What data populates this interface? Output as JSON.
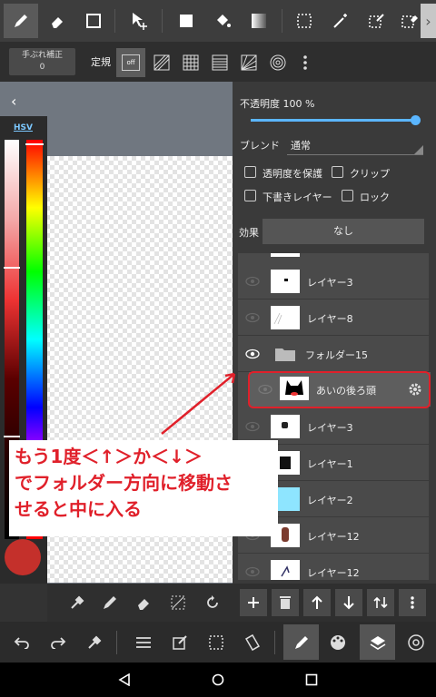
{
  "ruler_bar": {
    "stabilizer_label": "手ぶれ補正",
    "stabilizer_value": "0",
    "ruler_label": "定規",
    "off_label": "off"
  },
  "color_panel": {
    "mode_label": "HSV",
    "current_color": "#c4302b"
  },
  "layer_props": {
    "opacity_label": "不透明度 100 %",
    "opacity_value": 100,
    "blend_label": "ブレンド",
    "blend_value": "通常",
    "protect_alpha": "透明度を保護",
    "clipping": "クリップ",
    "draft_layer": "下書きレイヤー",
    "lock": "ロック",
    "effect_label": "効果",
    "effect_value": "なし"
  },
  "layers": [
    {
      "name": "レイヤー3"
    },
    {
      "name": "レイヤー8"
    },
    {
      "name": "フォルダー15"
    },
    {
      "name": "あいの後ろ頭"
    },
    {
      "name": "レイヤー3"
    },
    {
      "name": "レイヤー1"
    },
    {
      "name": "レイヤー2"
    },
    {
      "name": "レイヤー12"
    },
    {
      "name": "レイヤー12"
    }
  ],
  "annotation": {
    "line1": "もう1度＜↑＞か＜↓＞",
    "line2": "でフォルダー方向に移動さ",
    "line3": "せると中に入る"
  },
  "colors": {
    "accent": "#5bb6ff",
    "highlight": "#e0202a"
  }
}
